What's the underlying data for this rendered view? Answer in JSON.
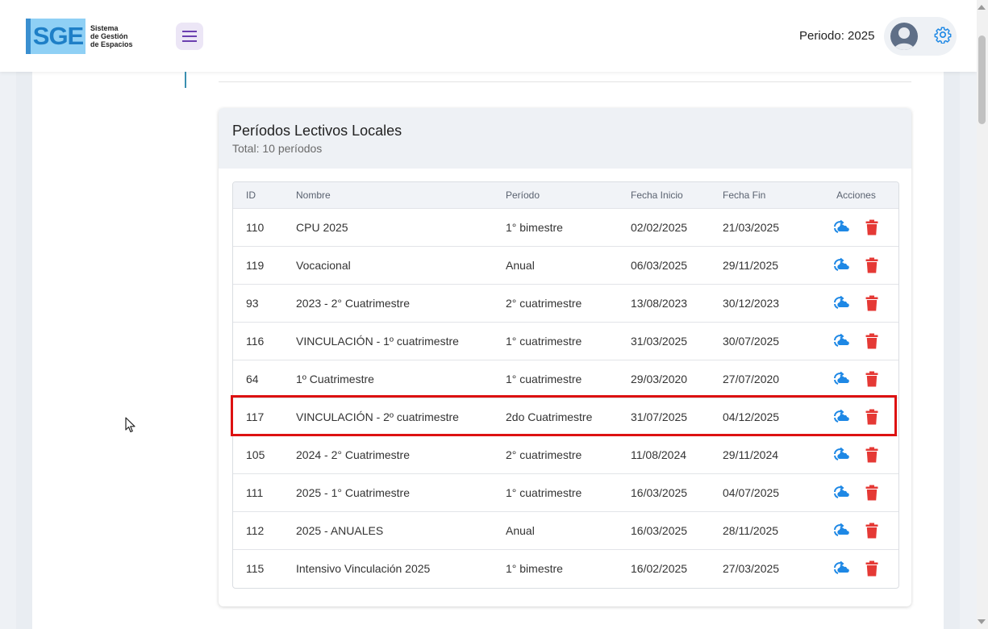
{
  "app": {
    "logo_mark": "SGE",
    "logo_lines": [
      "Sistema",
      "de Gestión",
      "de Espacios"
    ],
    "period_label": "Periodo: 2025",
    "accent": "#1e88e5"
  },
  "card": {
    "title": "Períodos Lectivos Locales",
    "subtitle": "Total: 10 períodos"
  },
  "table": {
    "headers": [
      "ID",
      "Nombre",
      "Período",
      "Fecha Inicio",
      "Fecha Fin",
      "Acciones"
    ],
    "rows": [
      {
        "id": "110",
        "nombre": "CPU 2025",
        "periodo": "1° bimestre",
        "inicio": "02/02/2025",
        "fin": "21/03/2025"
      },
      {
        "id": "119",
        "nombre": "Vocacional",
        "periodo": "Anual",
        "inicio": "06/03/2025",
        "fin": "29/11/2025"
      },
      {
        "id": "93",
        "nombre": "2023 - 2° Cuatrimestre",
        "periodo": "2° cuatrimestre",
        "inicio": "13/08/2023",
        "fin": "30/12/2023"
      },
      {
        "id": "116",
        "nombre": "VINCULACIÓN - 1º cuatrimestre",
        "periodo": "1° cuatrimestre",
        "inicio": "31/03/2025",
        "fin": "30/07/2025"
      },
      {
        "id": "64",
        "nombre": "1º Cuatrimestre",
        "periodo": "1° cuatrimestre",
        "inicio": "29/03/2020",
        "fin": "27/07/2020"
      },
      {
        "id": "117",
        "nombre": "VINCULACIÓN - 2º cuatrimestre",
        "periodo": "2do Cuatrimestre",
        "inicio": "31/07/2025",
        "fin": "04/12/2025"
      },
      {
        "id": "105",
        "nombre": "2024 - 2° Cuatrimestre",
        "periodo": "2° cuatrimestre",
        "inicio": "11/08/2024",
        "fin": "29/11/2024"
      },
      {
        "id": "111",
        "nombre": "2025 - 1° Cuatrimestre",
        "periodo": "1° cuatrimestre",
        "inicio": "16/03/2025",
        "fin": "04/07/2025"
      },
      {
        "id": "112",
        "nombre": "2025 - ANUALES",
        "periodo": "Anual",
        "inicio": "16/03/2025",
        "fin": "28/11/2025"
      },
      {
        "id": "115",
        "nombre": "Intensivo Vinculación 2025",
        "periodo": "1° bimestre",
        "inicio": "16/02/2025",
        "fin": "27/03/2025"
      }
    ],
    "row_actions": [
      "sync-cloud-icon",
      "trash-icon"
    ],
    "highlighted_row_id": "117",
    "highlight_color": "#dd1111"
  }
}
